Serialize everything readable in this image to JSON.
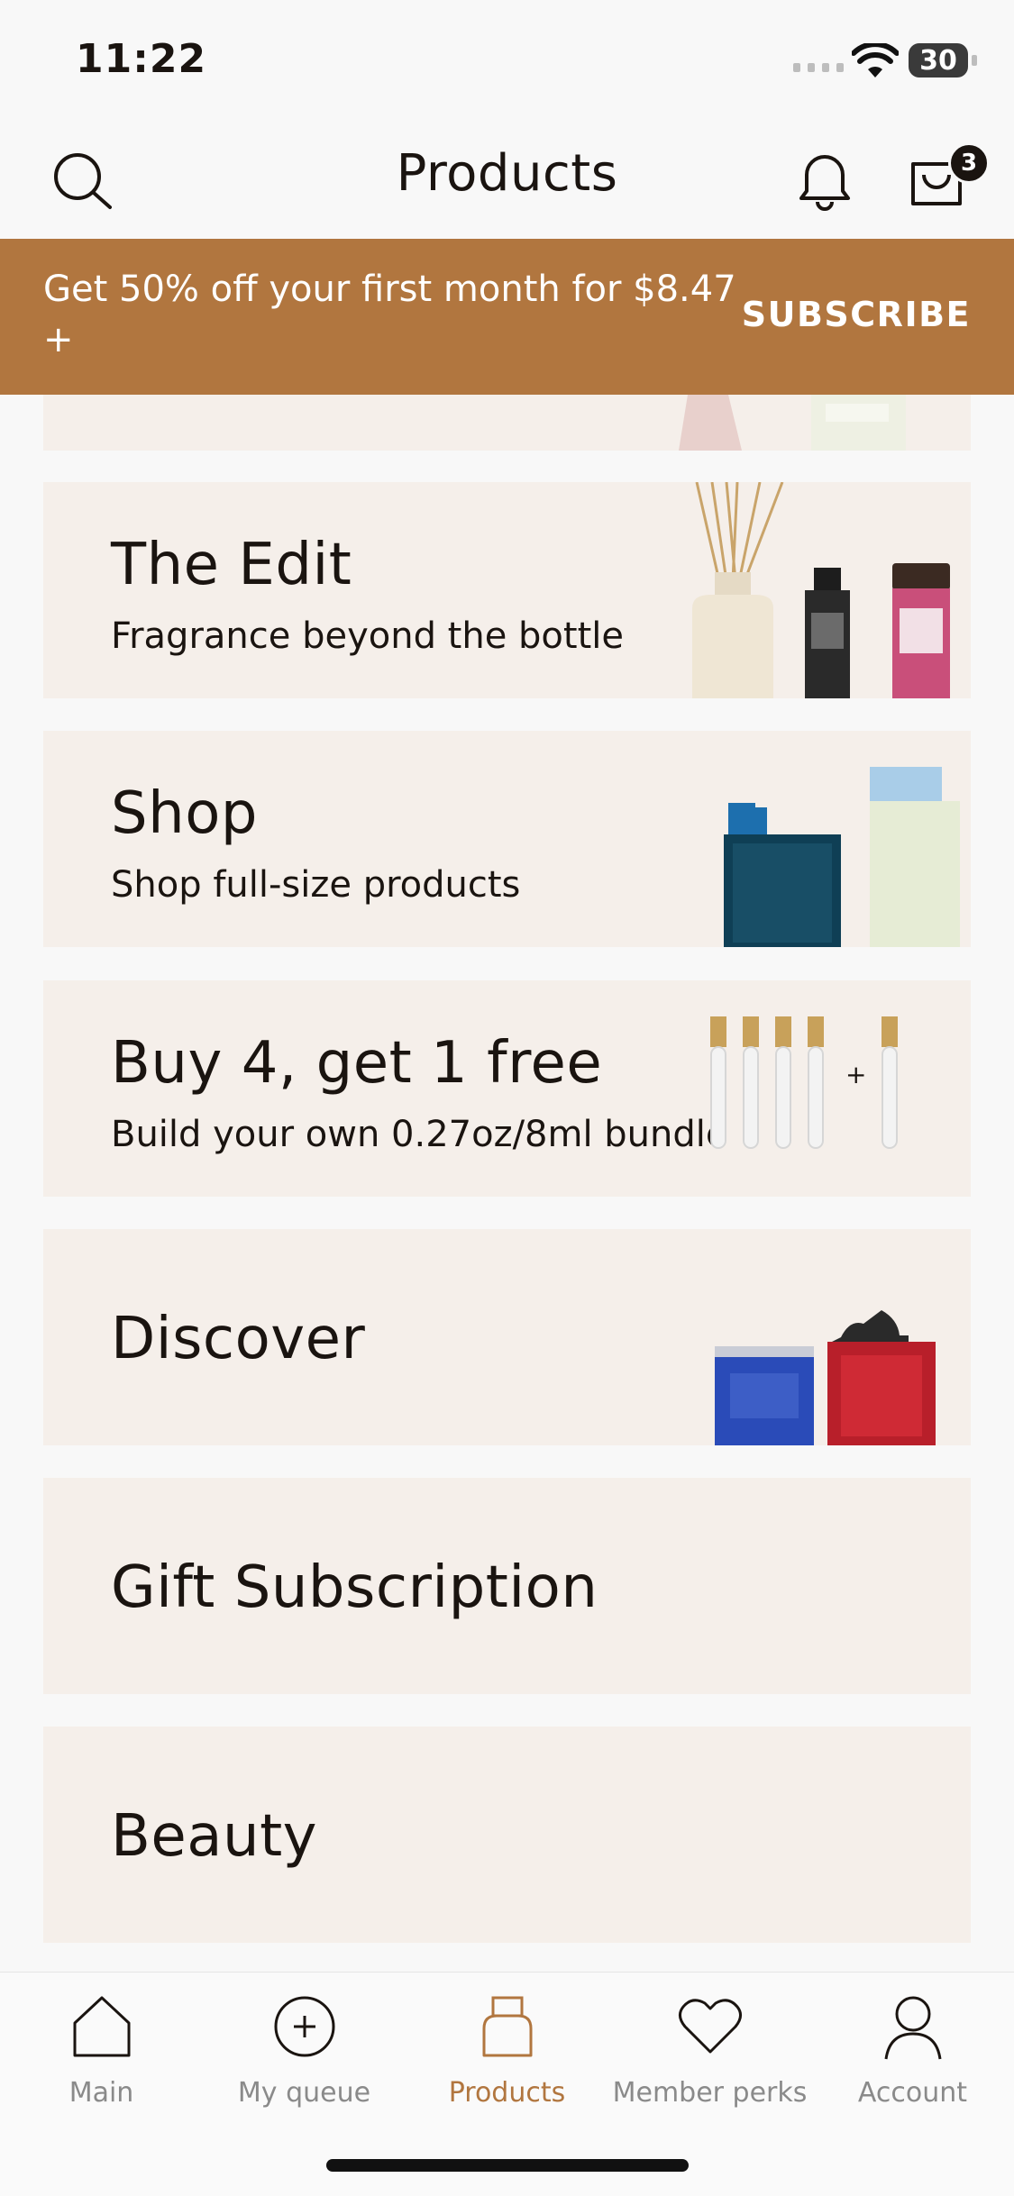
{
  "status_bar": {
    "time": "11:22",
    "battery": "30"
  },
  "header": {
    "title": "Products",
    "cart_count": "3"
  },
  "promo": {
    "text": "Get 50% off your first month for $8.47 +",
    "cta": "SUBSCRIBE"
  },
  "cards": [
    {
      "title": "The Edit",
      "subtitle": "Fragrance beyond the bottle"
    },
    {
      "title": "Shop",
      "subtitle": "Shop full-size products"
    },
    {
      "title": "Buy 4, get 1 free",
      "subtitle": "Build your own 0.27oz/8ml bundle"
    },
    {
      "title": "Discover",
      "subtitle": ""
    },
    {
      "title": "Gift Subscription",
      "subtitle": ""
    },
    {
      "title": "Beauty",
      "subtitle": ""
    }
  ],
  "tabbar": {
    "items": [
      {
        "label": "Main",
        "icon": "home-icon"
      },
      {
        "label": "My queue",
        "icon": "plus-circle-icon"
      },
      {
        "label": "Products",
        "icon": "bottle-icon"
      },
      {
        "label": "Member perks",
        "icon": "heart-icon"
      },
      {
        "label": "Account",
        "icon": "person-icon"
      }
    ],
    "active": "Products"
  },
  "colors": {
    "accent": "#b1763f",
    "card_bg": "#f5efea",
    "page_bg": "#f8f8f8",
    "text": "#1a1410"
  }
}
